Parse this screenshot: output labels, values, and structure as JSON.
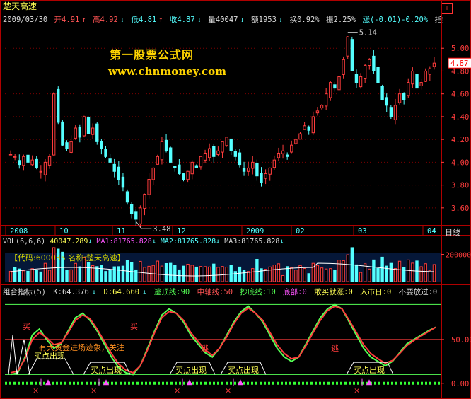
{
  "header": {
    "stock_name": "楚天高速",
    "date": "2009/03/30",
    "open": "开4.91",
    "high": "高4.92",
    "low": "低4.81",
    "close": "收4.87",
    "volume": "量40047",
    "amount": "额1953",
    "turnover": "换0.92%",
    "amplitude": "振2.25%",
    "change": "涨(-0.01)-0.20%",
    "index": "指数(-16.40"
  },
  "watermark": {
    "line1": "第一股票公式网",
    "line2": "www.chnmoney.com"
  },
  "price_panel": {
    "y_ticks": [
      "5.00",
      "4.80",
      "4.60",
      "4.40",
      "4.20",
      "4.00",
      "3.80",
      "3.60"
    ],
    "current_price_tag": "4.87",
    "high_note": "5.14",
    "low_note": "3.48"
  },
  "time_axis": {
    "labels": [
      "2008",
      "10",
      "11",
      "12",
      "2009",
      "02",
      "03",
      "04"
    ],
    "period": "日线"
  },
  "volume_panel": {
    "header": {
      "name": "VOL(6,6,6)",
      "vol": "40047.289",
      "ma1": "MA1:81765.828",
      "ma2": "MA2:81765.828",
      "ma3": "MA3:81765.828"
    },
    "code_bar": "【代码:600035 名称:楚天高速】",
    "y_tick": "200000"
  },
  "indicator_panel": {
    "header": {
      "name": "组合指标(5)",
      "k": "K:64.376",
      "d": "D:64.660",
      "escape_top": "逃顶线:90",
      "center": "中轴线:50",
      "bottom_line": "抄底线:10",
      "bottom": "底部:0",
      "dare_buy": "敢买就涨:0",
      "enter_market": "入市日:0",
      "no_miss": "不要放过:0",
      "buy": "买入"
    },
    "y_ticks": [
      "50.00",
      "0.00"
    ],
    "labels": {
      "buy_char": "买",
      "escape_char": "逃",
      "notice": "有大资金进场迹象，关注",
      "buy_point": "买点出现"
    }
  },
  "chart_data": [
    {
      "type": "candlestick",
      "title": "楚天高速",
      "x": [
        "2008",
        "10",
        "11",
        "12",
        "2009",
        "02",
        "03",
        "04"
      ],
      "ylim": [
        3.45,
        5.2
      ],
      "close_series": [
        4.07,
        4.05,
        3.98,
        4.05,
        4.0,
        4.02,
        3.95,
        3.92,
        4.0,
        4.05,
        4.6,
        4.35,
        4.15,
        4.12,
        4.18,
        4.3,
        4.22,
        4.4,
        4.25,
        4.3,
        4.18,
        4.12,
        4.05,
        4.0,
        3.92,
        3.85,
        3.78,
        3.65,
        3.55,
        3.5,
        3.6,
        3.72,
        3.85,
        3.95,
        4.05,
        4.18,
        4.1,
        4.0,
        3.95,
        3.9,
        3.85,
        3.92,
        4.0,
        3.95,
        4.05,
        4.08,
        4.12,
        4.05,
        4.1,
        4.18,
        4.22,
        4.1,
        4.05,
        3.98,
        3.92,
        3.95,
        4.0,
        3.88,
        3.82,
        3.9,
        3.95,
        4.02,
        4.08,
        4.1,
        4.05,
        4.15,
        4.2,
        4.25,
        4.32,
        4.28,
        4.4,
        4.45,
        4.5,
        4.6,
        4.7,
        4.65,
        4.75,
        4.9,
        5.1,
        4.8,
        4.7,
        4.75,
        4.85,
        4.9,
        4.8,
        4.7,
        4.55,
        4.5,
        4.4,
        4.5,
        4.6,
        4.55,
        4.7,
        4.8,
        4.65,
        4.7,
        4.8,
        4.82,
        4.87
      ],
      "high": 5.14,
      "low": 3.48
    },
    {
      "type": "bar",
      "title": "VOL(6,6,6)",
      "ylim": [
        0,
        260000
      ],
      "y_ticks": [
        200000
      ]
    },
    {
      "type": "line",
      "title": "组合指标(5)",
      "ylim": [
        -5,
        100
      ],
      "series": [
        {
          "name": "K",
          "values": [
            10,
            12,
            30,
            55,
            62,
            50,
            40,
            45,
            60,
            75,
            80,
            72,
            60,
            45,
            30,
            18,
            12,
            10,
            20,
            40,
            60,
            78,
            85,
            80,
            70,
            55,
            45,
            35,
            30,
            40,
            55,
            70,
            82,
            88,
            80,
            70,
            55,
            40,
            30,
            25,
            30,
            45,
            60,
            75,
            85,
            90,
            85,
            70,
            55,
            40,
            30,
            25,
            20,
            25,
            35,
            45,
            50,
            55,
            60,
            64
          ]
        },
        {
          "name": "D",
          "values": [
            12,
            14,
            28,
            50,
            58,
            52,
            44,
            46,
            58,
            72,
            78,
            74,
            62,
            48,
            34,
            22,
            15,
            12,
            20,
            38,
            58,
            75,
            82,
            80,
            72,
            58,
            48,
            38,
            32,
            40,
            53,
            68,
            80,
            86,
            80,
            72,
            58,
            44,
            34,
            28,
            30,
            43,
            58,
            72,
            83,
            88,
            85,
            72,
            58,
            44,
            34,
            28,
            23,
            26,
            34,
            43,
            49,
            54,
            59,
            64
          ]
        }
      ],
      "lines": {
        "escape_top": 90,
        "center": 50,
        "bottom_line": 10,
        "bottom": 0
      }
    }
  ]
}
